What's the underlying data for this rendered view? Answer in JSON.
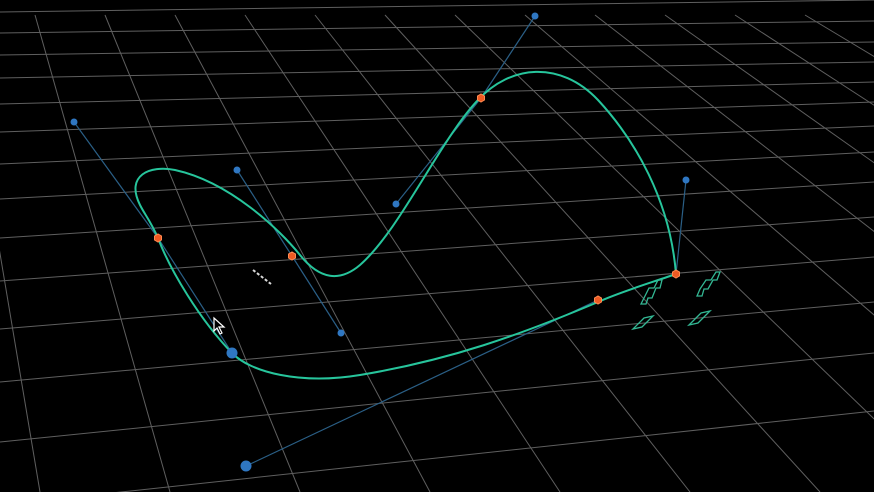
{
  "scene": {
    "background": "#000000",
    "grid_color": "#5f5f5f",
    "spline_color": "#27c59c",
    "tangent_color": "#2a5f86",
    "handle_color": "#2f77c2",
    "control_point_color": "#ee5a23"
  },
  "icons": {
    "cursor": "mouse-pointer-icon",
    "transform_gizmo": "transform-gizmo-icon",
    "dash_marker": "dash-marker-icon"
  }
}
